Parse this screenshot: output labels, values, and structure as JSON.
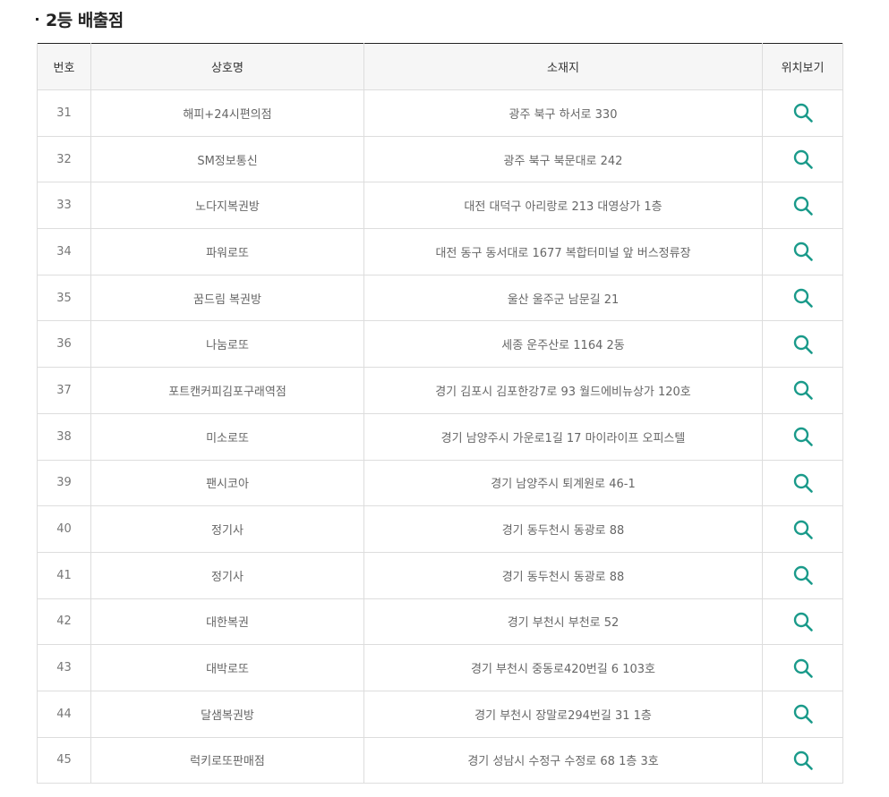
{
  "section": {
    "title": "2등 배출점"
  },
  "table": {
    "headers": {
      "no": "번호",
      "name": "상호명",
      "address": "소재지",
      "map": "위치보기"
    },
    "rows": [
      {
        "no": "31",
        "name": "해피+24시편의점",
        "address": "광주 북구 하서로 330"
      },
      {
        "no": "32",
        "name": "SM정보통신",
        "address": "광주 북구 북문대로 242"
      },
      {
        "no": "33",
        "name": "노다지복권방",
        "address": "대전 대덕구 아리랑로 213 대영상가 1층"
      },
      {
        "no": "34",
        "name": "파워로또",
        "address": "대전 동구 동서대로 1677 복합터미널 앞 버스정류장"
      },
      {
        "no": "35",
        "name": "꿈드림 복권방",
        "address": "울산 울주군 남문길 21"
      },
      {
        "no": "36",
        "name": "나눔로또",
        "address": "세종 운주산로 1164 2동"
      },
      {
        "no": "37",
        "name": "포트캔커피김포구래역점",
        "address": "경기 김포시 김포한강7로 93 월드에비뉴상가 120호"
      },
      {
        "no": "38",
        "name": "미소로또",
        "address": "경기 남양주시 가운로1길 17 마이라이프 오피스텔"
      },
      {
        "no": "39",
        "name": "팬시코아",
        "address": "경기 남양주시 퇴계원로 46-1"
      },
      {
        "no": "40",
        "name": "정기사",
        "address": "경기 동두천시 동광로 88"
      },
      {
        "no": "41",
        "name": "정기사",
        "address": "경기 동두천시 동광로 88"
      },
      {
        "no": "42",
        "name": "대한복권",
        "address": "경기 부천시 부천로 52"
      },
      {
        "no": "43",
        "name": "대박로또",
        "address": "경기 부천시 중동로420번길 6 103호"
      },
      {
        "no": "44",
        "name": "달샘복권방",
        "address": "경기 부천시 장말로294번길 31 1층"
      },
      {
        "no": "45",
        "name": "럭키로또판매점",
        "address": "경기 성남시 수정구 수정로 68 1층 3호"
      }
    ]
  },
  "icons": {
    "map_view": "search-icon"
  },
  "colors": {
    "icon": "#1a9a8a",
    "header_bg": "#f6f6f6",
    "table_top_border": "#222222",
    "cell_border": "#dddddd"
  }
}
